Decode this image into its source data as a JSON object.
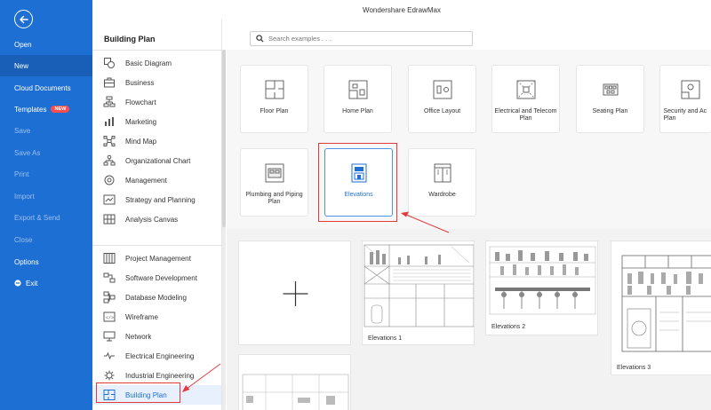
{
  "app": {
    "title": "Wondershare EdrawMax"
  },
  "left_nav": {
    "items": [
      {
        "label": "Open"
      },
      {
        "label": "New",
        "active": true
      },
      {
        "label": "Cloud Documents"
      },
      {
        "label": "Templates",
        "badge": "NEW"
      },
      {
        "label": "Save"
      },
      {
        "label": "Save As"
      },
      {
        "label": "Print"
      },
      {
        "label": "Import"
      },
      {
        "label": "Export & Send"
      },
      {
        "label": "Close"
      },
      {
        "label": "Options"
      },
      {
        "label": "Exit"
      }
    ]
  },
  "category_panel": {
    "heading": "Building Plan",
    "group1": [
      {
        "label": "Basic Diagram",
        "icon": "shapes-icon"
      },
      {
        "label": "Business",
        "icon": "briefcase-icon"
      },
      {
        "label": "Flowchart",
        "icon": "flowchart-icon"
      },
      {
        "label": "Marketing",
        "icon": "bar-chart-icon"
      },
      {
        "label": "Mind Map",
        "icon": "mind-map-icon"
      },
      {
        "label": "Organizational Chart",
        "icon": "org-chart-icon"
      },
      {
        "label": "Management",
        "icon": "management-icon"
      },
      {
        "label": "Strategy and Planning",
        "icon": "strategy-icon"
      },
      {
        "label": "Analysis Canvas",
        "icon": "canvas-icon"
      }
    ],
    "group2": [
      {
        "label": "Project Management",
        "icon": "gantt-icon"
      },
      {
        "label": "Software Development",
        "icon": "software-icon"
      },
      {
        "label": "Database Modeling",
        "icon": "database-icon"
      },
      {
        "label": "Wireframe",
        "icon": "wireframe-icon"
      },
      {
        "label": "Network",
        "icon": "network-icon"
      },
      {
        "label": "Electrical Engineering",
        "icon": "electrical-icon"
      },
      {
        "label": "Industrial Engineering",
        "icon": "industrial-icon"
      },
      {
        "label": "Building Plan",
        "icon": "building-plan-icon",
        "selected": true
      }
    ]
  },
  "search": {
    "placeholder": "Search examples . . ."
  },
  "diagram_types": [
    {
      "label": "Floor Plan"
    },
    {
      "label": "Home Plan"
    },
    {
      "label": "Office Layout"
    },
    {
      "label": "Electrical and Telecom Plan"
    },
    {
      "label": "Seating Plan"
    },
    {
      "label": "Security and Ac Plan"
    },
    {
      "label": "Plumbing and Piping Plan"
    },
    {
      "label": "Elevations",
      "selected": true
    },
    {
      "label": "Wardrobe"
    }
  ],
  "templates": [
    {
      "label": "",
      "kind": "new-blank"
    },
    {
      "label": "Elevations 1"
    },
    {
      "label": "Elevations 2"
    },
    {
      "label": "Elevations 3"
    },
    {
      "label": ""
    }
  ],
  "colors": {
    "brand": "#1e6fd3",
    "highlight": "#e23b3b"
  }
}
